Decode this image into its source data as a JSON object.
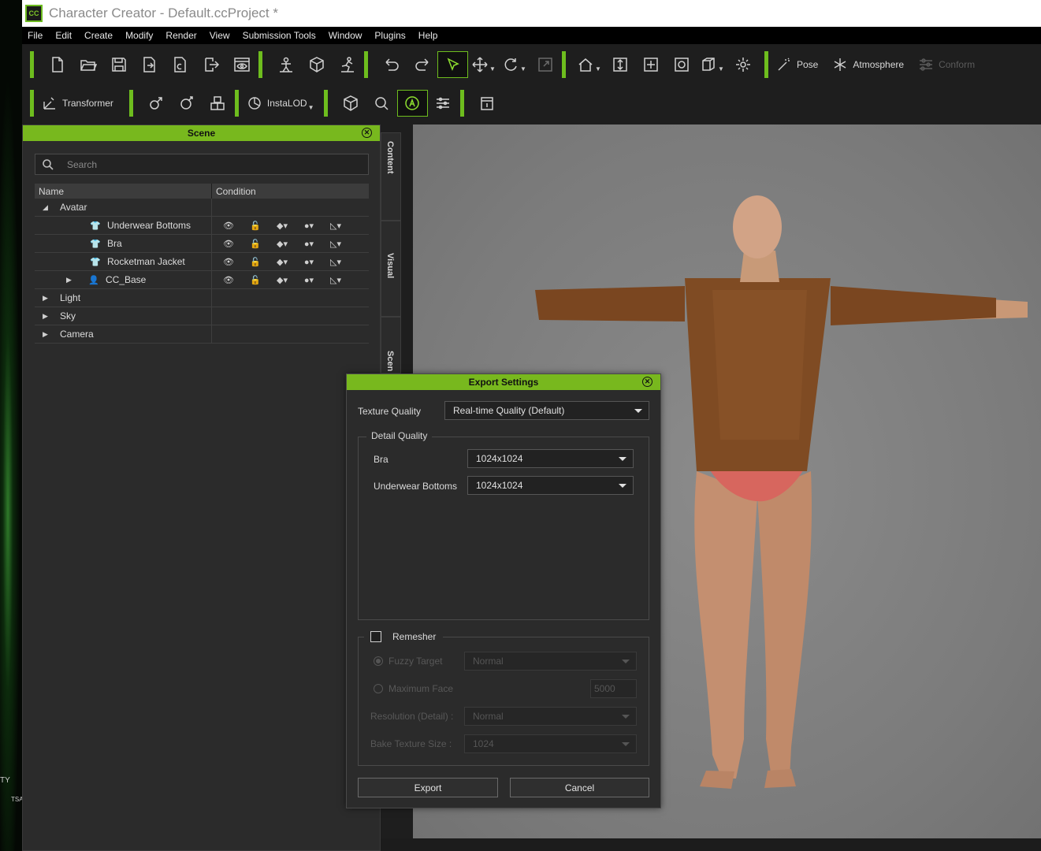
{
  "window": {
    "title": "Character Creator - Default.ccProject *",
    "app_logo": "CC"
  },
  "desktop": {
    "text1": "TY",
    "text2": "TSA"
  },
  "menu": [
    "File",
    "Edit",
    "Create",
    "Modify",
    "Render",
    "View",
    "Submission Tools",
    "Window",
    "Plugins",
    "Help"
  ],
  "toolbar": {
    "pose": "Pose",
    "atmosphere": "Atmosphere",
    "conform": "Conform"
  },
  "toolbar2": {
    "transformer": "Transformer",
    "instalod": "InstaLOD"
  },
  "scene": {
    "title": "Scene",
    "search_placeholder": "Search",
    "col_name": "Name",
    "col_condition": "Condition",
    "items": [
      {
        "label": "Avatar"
      },
      {
        "label": "Underwear Bottoms"
      },
      {
        "label": "Bra"
      },
      {
        "label": "Rocketman Jacket"
      },
      {
        "label": "CC_Base"
      },
      {
        "label": "Light"
      },
      {
        "label": "Sky"
      },
      {
        "label": "Camera"
      }
    ]
  },
  "side_tabs": {
    "content": "Content",
    "visual": "Visual",
    "scene": "Scen"
  },
  "export": {
    "title": "Export Settings",
    "texture_quality_label": "Texture Quality",
    "texture_quality_value": "Real-time Quality (Default)",
    "detail_quality_title": "Detail Quality",
    "bra_label": "Bra",
    "bra_value": "1024x1024",
    "underwear_label": "Underwear Bottoms",
    "underwear_value": "1024x1024",
    "remesher_label": "Remesher",
    "fuzzy_label": "Fuzzy Target",
    "fuzzy_value": "Normal",
    "maxface_label": "Maximum Face",
    "maxface_value": "5000",
    "resolution_label": "Resolution (Detail) :",
    "resolution_value": "Normal",
    "bake_label": "Bake Texture Size :",
    "bake_value": "1024",
    "export_button": "Export",
    "cancel_button": "Cancel"
  }
}
